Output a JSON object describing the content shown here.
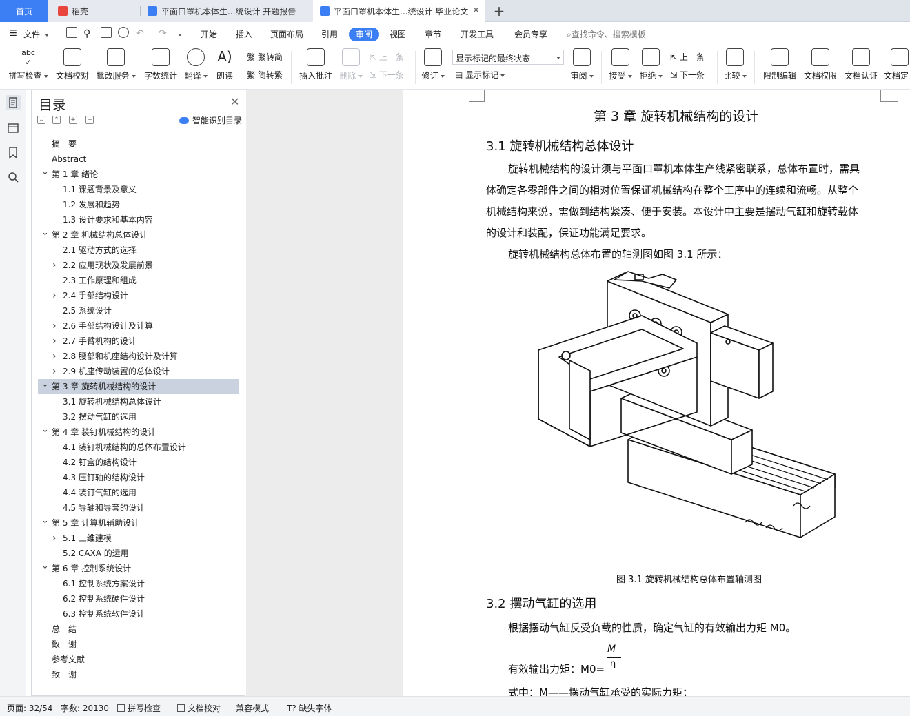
{
  "tabs": {
    "home": "首页",
    "daoke": "稻壳",
    "doc1": "平面口罩机本体生...统设计 开题报告",
    "doc2": "平面口罩机本体生...统设计 毕业论文",
    "new_tab": "+"
  },
  "menu": {
    "file": "文件",
    "items": [
      "开始",
      "插入",
      "页面布局",
      "引用",
      "审阅",
      "视图",
      "章节",
      "开发工具",
      "会员专享"
    ],
    "search": "查找命令、搜索模板"
  },
  "ribbon": {
    "spell": "拼写检查",
    "proof": "文档校对",
    "batch": "批改服务",
    "wordcount": "字数统计",
    "translate": "翻译",
    "read": "朗读",
    "to_trad": "繁转简",
    "to_simp": "简转繁",
    "insert_comment": "插入批注",
    "delete": "删除",
    "prev_comment": "上一条",
    "next_comment": "下一条",
    "track": "修订",
    "display_select": "显示标记的最终状态",
    "show_markup": "显示标记",
    "review": "审阅",
    "accept": "接受",
    "reject": "拒绝",
    "prev": "上一条",
    "next": "下一条",
    "compare": "比较",
    "restrict": "限制编辑",
    "rights": "文档权限",
    "certify": "文档认证",
    "finalize": "文档定"
  },
  "toc": {
    "title": "目录",
    "smart": "智能识别目录",
    "items": [
      {
        "text": "摘　要",
        "level": 0,
        "arrow": ""
      },
      {
        "text": "Abstract",
        "level": 0,
        "arrow": ""
      },
      {
        "text": "第 1 章  绪论",
        "level": 0,
        "arrow": "down"
      },
      {
        "text": "1.1  课题背景及意义",
        "level": 1,
        "arrow": ""
      },
      {
        "text": "1.2  发展和趋势",
        "level": 1,
        "arrow": ""
      },
      {
        "text": "1.3  设计要求和基本内容",
        "level": 1,
        "arrow": ""
      },
      {
        "text": "第 2 章  机械结构总体设计",
        "level": 0,
        "arrow": "down"
      },
      {
        "text": "2.1  驱动方式的选择",
        "level": 1,
        "arrow": ""
      },
      {
        "text": "2.2  应用现状及发展前景",
        "level": 1,
        "arrow": "right"
      },
      {
        "text": "2.3  工作原理和组成",
        "level": 1,
        "arrow": ""
      },
      {
        "text": "2.4 手部结构设计",
        "level": 1,
        "arrow": "right"
      },
      {
        "text": "2.5 系统设计",
        "level": 1,
        "arrow": ""
      },
      {
        "text": "2.6 手部结构设计及计算",
        "level": 1,
        "arrow": "right"
      },
      {
        "text": "2.7 手臂机构的设计",
        "level": 1,
        "arrow": "right"
      },
      {
        "text": "2.8 腰部和机座结构设计及计算",
        "level": 1,
        "arrow": "right"
      },
      {
        "text": "2.9 机座传动装置的总体设计",
        "level": 1,
        "arrow": "right"
      },
      {
        "text": "第 3 章  旋转机械结构的设计",
        "level": 0,
        "arrow": "down",
        "selected": true
      },
      {
        "text": "3.1 旋转机械结构总体设计",
        "level": 1,
        "arrow": ""
      },
      {
        "text": "3.2 摆动气缸的选用",
        "level": 1,
        "arrow": ""
      },
      {
        "text": "第 4 章  装钉机械结构的设计",
        "level": 0,
        "arrow": "down"
      },
      {
        "text": "4.1  装钉机械结构的总体布置设计",
        "level": 1,
        "arrow": ""
      },
      {
        "text": "4.2 钉盒的结构设计",
        "level": 1,
        "arrow": ""
      },
      {
        "text": "4.3 压钉轴的结构设计",
        "level": 1,
        "arrow": ""
      },
      {
        "text": "4.4 装钉气缸的选用",
        "level": 1,
        "arrow": ""
      },
      {
        "text": "4.5 导轴和导套的设计",
        "level": 1,
        "arrow": ""
      },
      {
        "text": "第 5 章  计算机辅助设计",
        "level": 0,
        "arrow": "down"
      },
      {
        "text": "5.1  三维建模",
        "level": 1,
        "arrow": "right"
      },
      {
        "text": "5.2 CAXA 的运用",
        "level": 1,
        "arrow": ""
      },
      {
        "text": "第 6 章  控制系统设计",
        "level": 0,
        "arrow": "down"
      },
      {
        "text": "6.1 控制系统方案设计",
        "level": 1,
        "arrow": ""
      },
      {
        "text": "6.2 控制系统硬件设计",
        "level": 1,
        "arrow": ""
      },
      {
        "text": "6.3 控制系统软件设计",
        "level": 1,
        "arrow": ""
      },
      {
        "text": "总　结",
        "level": 0,
        "arrow": ""
      },
      {
        "text": "致　谢",
        "level": 0,
        "arrow": ""
      },
      {
        "text": "参考文献",
        "level": 0,
        "arrow": ""
      },
      {
        "text": "致　谢",
        "level": 0,
        "arrow": ""
      }
    ]
  },
  "doc": {
    "chapter_title": "第 3 章  旋转机械结构的设计",
    "s31_title": "3.1 旋转机械结构总体设计",
    "p1_l1": "旋转机械结构的设计须与平面口罩机本体生产线紧密联系，总体布置时，需具",
    "p1_l2": "体确定各零部件之间的相对位置保证机械结构在整个工序中的连续和流畅。从整个",
    "p1_l3": "机械结构来说，需做到结构紧凑、便于安装。本设计中主要是摆动气缸和旋转载体",
    "p1_l4": "的设计和装配，保证功能满足要求。",
    "p2": "旋转机械结构总体布置的轴测图如图 3.1 所示：",
    "fig_caption": "图 3.1  旋转机械结构总体布置轴测图",
    "s32_title": "3.2 摆动气缸的选用",
    "p3": "根据摆动气缸反受负载的性质，确定气缸的有效输出力矩 M0。",
    "formula_label": "有效输出力矩：M0=",
    "formula_num": "M",
    "formula_den": "η",
    "p4": "式中：M——摆动气缸承受的实际力矩；"
  },
  "status": {
    "page": "页面: 32/54",
    "words": "字数: 20130",
    "spell": "拼写检查",
    "proof": "文档校对",
    "compat": "兼容模式",
    "missing_font": "缺失字体"
  }
}
